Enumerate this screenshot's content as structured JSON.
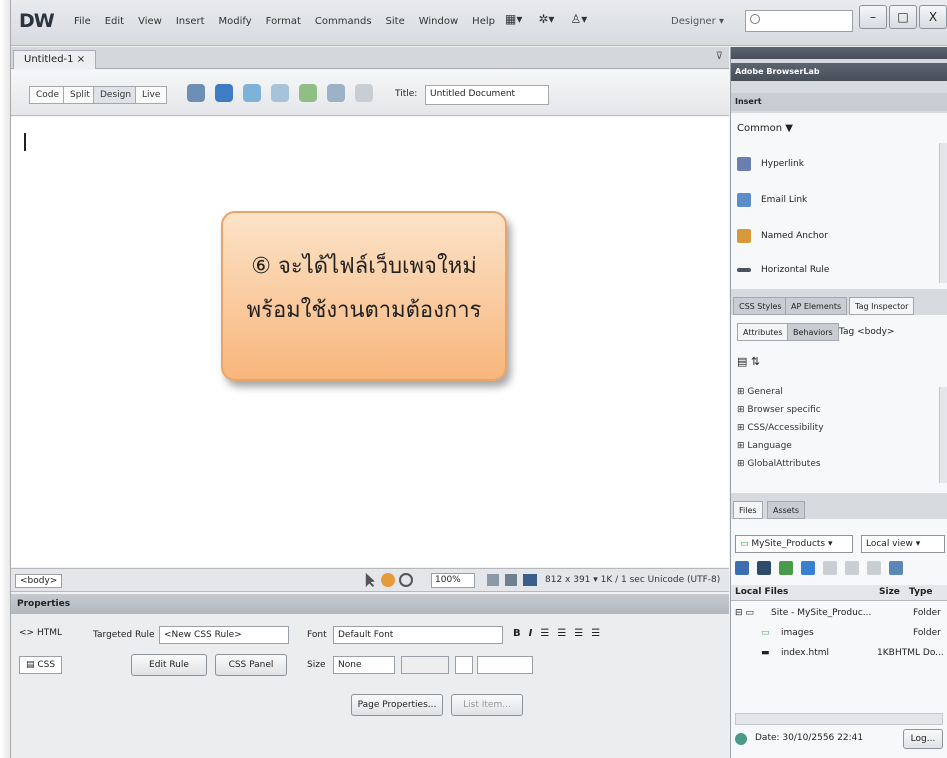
{
  "app": {
    "logo": "DW"
  },
  "menu": [
    "File",
    "Edit",
    "View",
    "Insert",
    "Modify",
    "Format",
    "Commands",
    "Site",
    "Window",
    "Help"
  ],
  "workspace": "Designer ▾",
  "window_buttons": [
    "–",
    "□",
    "X"
  ],
  "doc_tab": "Untitled-1 ×",
  "view_buttons": [
    "Code",
    "Split",
    "Design",
    "Live"
  ],
  "title_label": "Title:",
  "title_value": "Untitled Document",
  "callout": {
    "number": "⑥",
    "line1": "จะได้ไฟล์เว็บเพจใหม่",
    "line2": "พร้อมใช้งานตามต้องการ"
  },
  "status": {
    "tag": "<body>",
    "zoom": "100%",
    "info": "812 x 391 ▾  1K / 1 sec  Unicode (UTF-8)"
  },
  "properties": {
    "header": "Properties",
    "html_label": "HTML",
    "css_label": "CSS",
    "targeted_rule_label": "Targeted Rule",
    "targeted_rule_value": "<New CSS Rule>",
    "edit_rule": "Edit Rule",
    "css_panel": "CSS Panel",
    "font_label": "Font",
    "font_value": "Default Font",
    "size_label": "Size",
    "size_value": "None",
    "page_properties": "Page Properties...",
    "list_item": "List Item..."
  },
  "panels": {
    "browserlab": "Adobe BrowserLab",
    "insert": "Insert",
    "category": "Common ▼",
    "insert_items": [
      "Hyperlink",
      "Email Link",
      "Named Anchor",
      "Horizontal Rule"
    ],
    "tabs_css": [
      "CSS Styles",
      "AP Elements",
      "Tag Inspector"
    ],
    "subtabs": [
      "Attributes",
      "Behaviors",
      "Tag <body>"
    ],
    "tree": [
      "⊞ General",
      "⊞ Browser specific",
      "⊞ CSS/Accessibility",
      "⊞ Language",
      "⊞ GlobalAttributes"
    ],
    "files_tabs": [
      "Files",
      "Assets"
    ],
    "site": "MySite_Products",
    "view": "Local view",
    "local_files_label": "Local Files",
    "size_col": "Size",
    "type_col": "Type",
    "files": [
      {
        "name": "Site - MySite_Produc...",
        "size": "",
        "type": "Folder"
      },
      {
        "name": "images",
        "size": "",
        "type": "Folder"
      },
      {
        "name": "index.html",
        "size": "1KB",
        "type": "HTML Do..."
      }
    ],
    "date": "Date: 30/10/2556 22:41",
    "log": "Log..."
  }
}
